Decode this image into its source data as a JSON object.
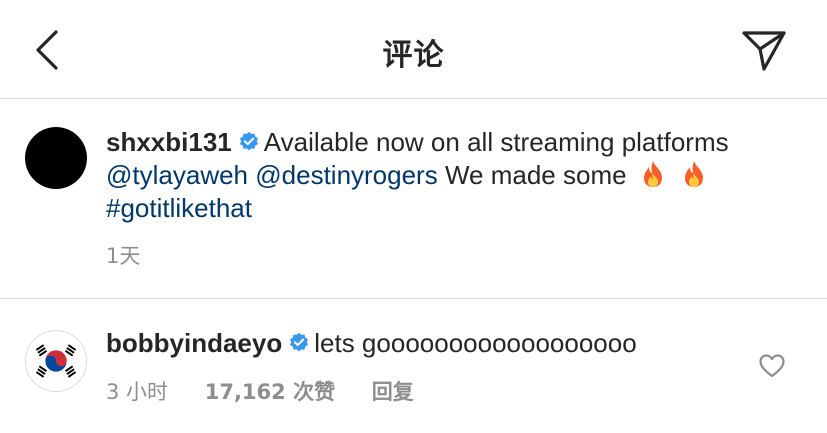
{
  "header": {
    "title": "评论",
    "back_icon": "chevron-left-icon",
    "send_icon": "paper-plane-icon"
  },
  "post": {
    "username": "shxxbi131",
    "caption_text": "Available now on all streaming platforms",
    "mention_1": "@tylayaweh",
    "mention_2": "@destinyrogers",
    "text_after_mentions": "We made some",
    "hashtag": "#gotitlikethat",
    "time": "1天",
    "verified_icon": "verified-badge-icon",
    "emoji_icon": "fire-emoji-icon"
  },
  "comment": {
    "username": "bobbyindaeyo",
    "text": "lets goooooooooooooooooo",
    "time": "3 小时",
    "likes": "17,162 次赞",
    "reply_label": "回复",
    "like_icon": "heart-outline-icon",
    "avatar_icon": "korean-flag-icon"
  },
  "colors": {
    "link": "#00376b",
    "verified": "#3897f0",
    "muted": "#8e8e8e",
    "divider": "#dbdbdb"
  }
}
